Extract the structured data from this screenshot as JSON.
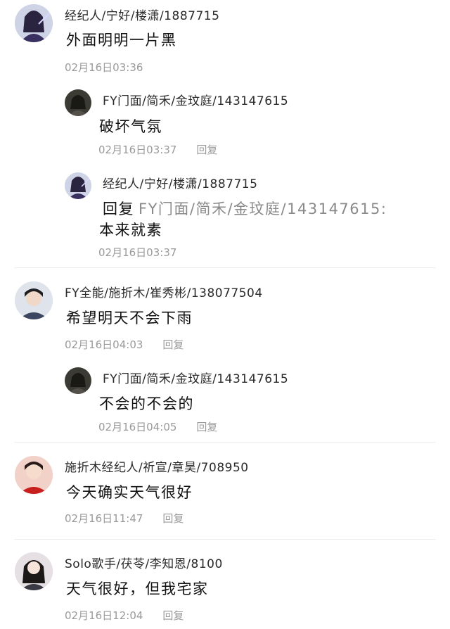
{
  "comments": [
    {
      "name": "经纪人/宁好/楼潇/1887715",
      "text": "外面明明一片黑",
      "time": "02月16日03:36",
      "reply_label": "",
      "replies": [
        {
          "name": "FY门面/简禾/金玟庭/143147615",
          "text": "破坏气氛",
          "time": "02月16日03:37",
          "reply_label": "回复"
        },
        {
          "name": "经纪人/宁好/楼潇/1887715",
          "reply_prefix": "回复",
          "reply_target": "FY门面/简禾/金玟庭/143147615:",
          "text": "本来就素",
          "time": "02月16日03:37",
          "reply_label": ""
        }
      ]
    },
    {
      "name": "FY全能/施折木/崔秀彬/138077504",
      "text": "希望明天不会下雨",
      "time": "02月16日04:03",
      "reply_label": "回复",
      "replies": [
        {
          "name": "FY门面/简禾/金玟庭/143147615",
          "text": "不会的不会的",
          "time": "02月16日04:05",
          "reply_label": "回复"
        }
      ]
    },
    {
      "name": "施折木经纪人/祈宣/章昊/708950",
      "text": "今天确实天气很好",
      "time": "02月16日11:47",
      "reply_label": "回复",
      "replies": []
    },
    {
      "name": "Solo歌手/茯苓/李知恩/8100",
      "text": "天气很好，但我宅家",
      "time": "02月16日12:04",
      "reply_label": "回复",
      "replies": []
    }
  ],
  "colors": {
    "name": "#2a2a2a",
    "text": "#111111",
    "meta": "#9a9a9a",
    "divider": "#ececec"
  }
}
